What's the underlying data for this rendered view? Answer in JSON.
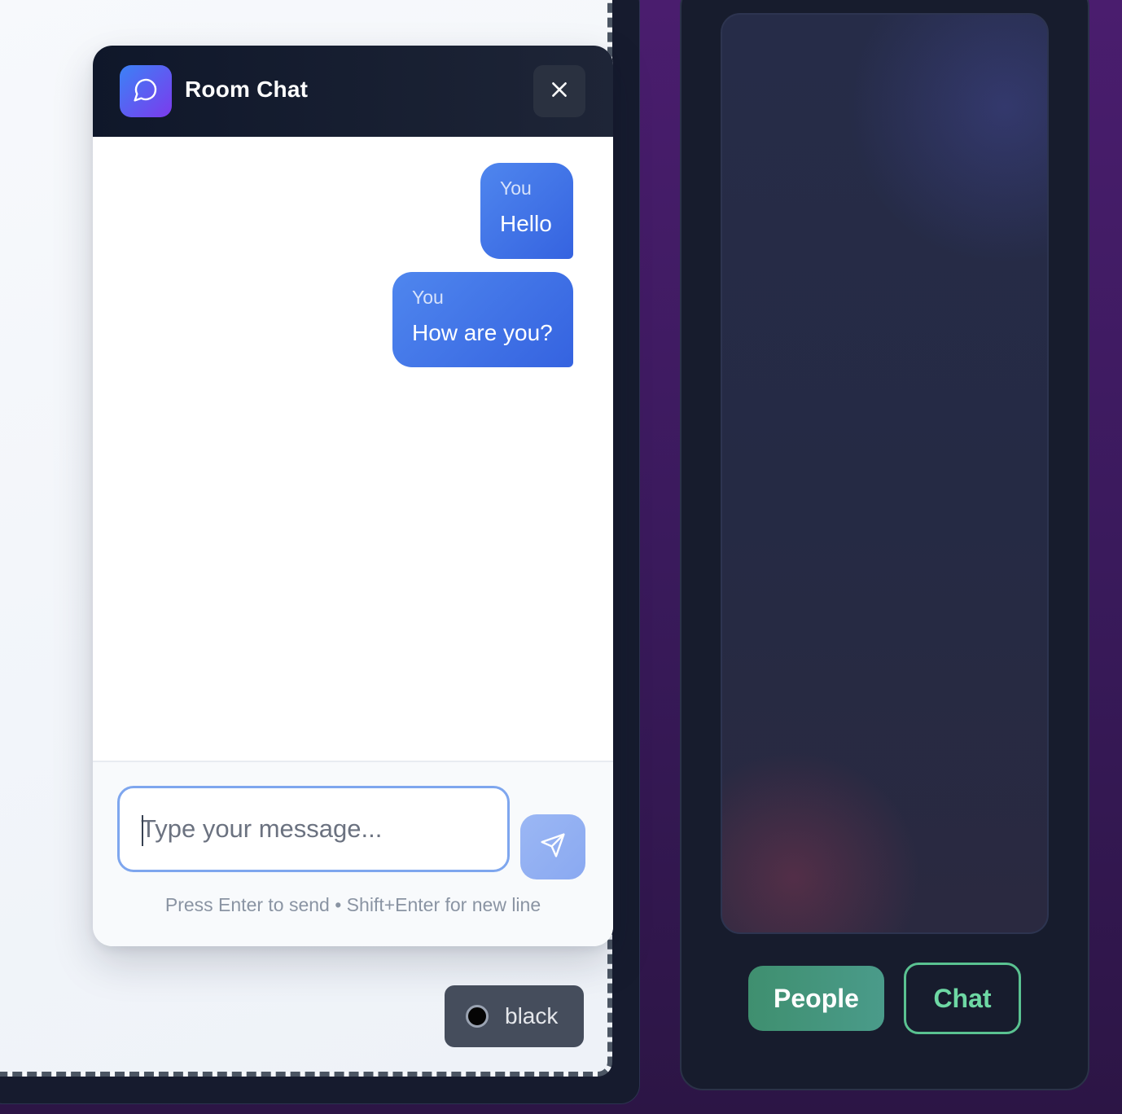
{
  "chat": {
    "title": "Room Chat",
    "messages": [
      {
        "sender": "You",
        "text": "Hello"
      },
      {
        "sender": "You",
        "text": "How are you?"
      }
    ],
    "input_placeholder": "Type your message...",
    "hint": "Press Enter to send • Shift+Enter for new line"
  },
  "color_picker": {
    "label": "black",
    "swatch_color": "#000000"
  },
  "tabs": {
    "people_label": "People",
    "chat_label": "Chat"
  },
  "icons": {
    "logo": "chat-bubble-icon",
    "close": "close-icon",
    "send": "send-icon"
  },
  "colors": {
    "accent_blue": "#3b82f6",
    "accent_purple": "#7c3aed",
    "accent_green": "#4a9b7a"
  }
}
